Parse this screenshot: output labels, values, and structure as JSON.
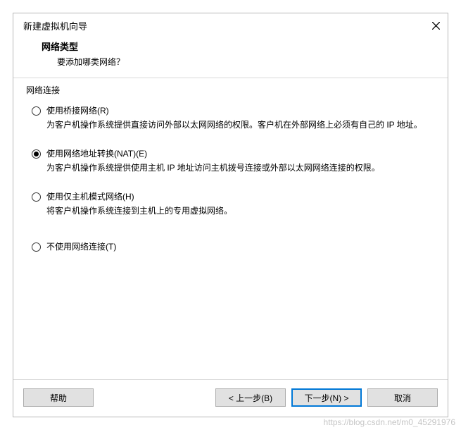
{
  "dialog": {
    "title": "新建虚拟机向导",
    "header": {
      "title": "网络类型",
      "subtitle": "要添加哪类网络？"
    },
    "group_label": "网络连接",
    "options": [
      {
        "label": "使用桥接网络(R)",
        "desc": "为客户机操作系统提供直接访问外部以太网网络的权限。客户机在外部网络上必须有自己的 IP 地址。",
        "checked": false
      },
      {
        "label": "使用网络地址转换(NAT)(E)",
        "desc": "为客户机操作系统提供使用主机 IP 地址访问主机拨号连接或外部以太网网络连接的权限。",
        "checked": true
      },
      {
        "label": "使用仅主机模式网络(H)",
        "desc": "将客户机操作系统连接到主机上的专用虚拟网络。",
        "checked": false
      },
      {
        "label": "不使用网络连接(T)",
        "desc": "",
        "checked": false
      }
    ],
    "buttons": {
      "help": "帮助",
      "back": "< 上一步(B)",
      "next": "下一步(N) >",
      "cancel": "取消"
    }
  },
  "watermark": "https://blog.csdn.net/m0_45291976"
}
